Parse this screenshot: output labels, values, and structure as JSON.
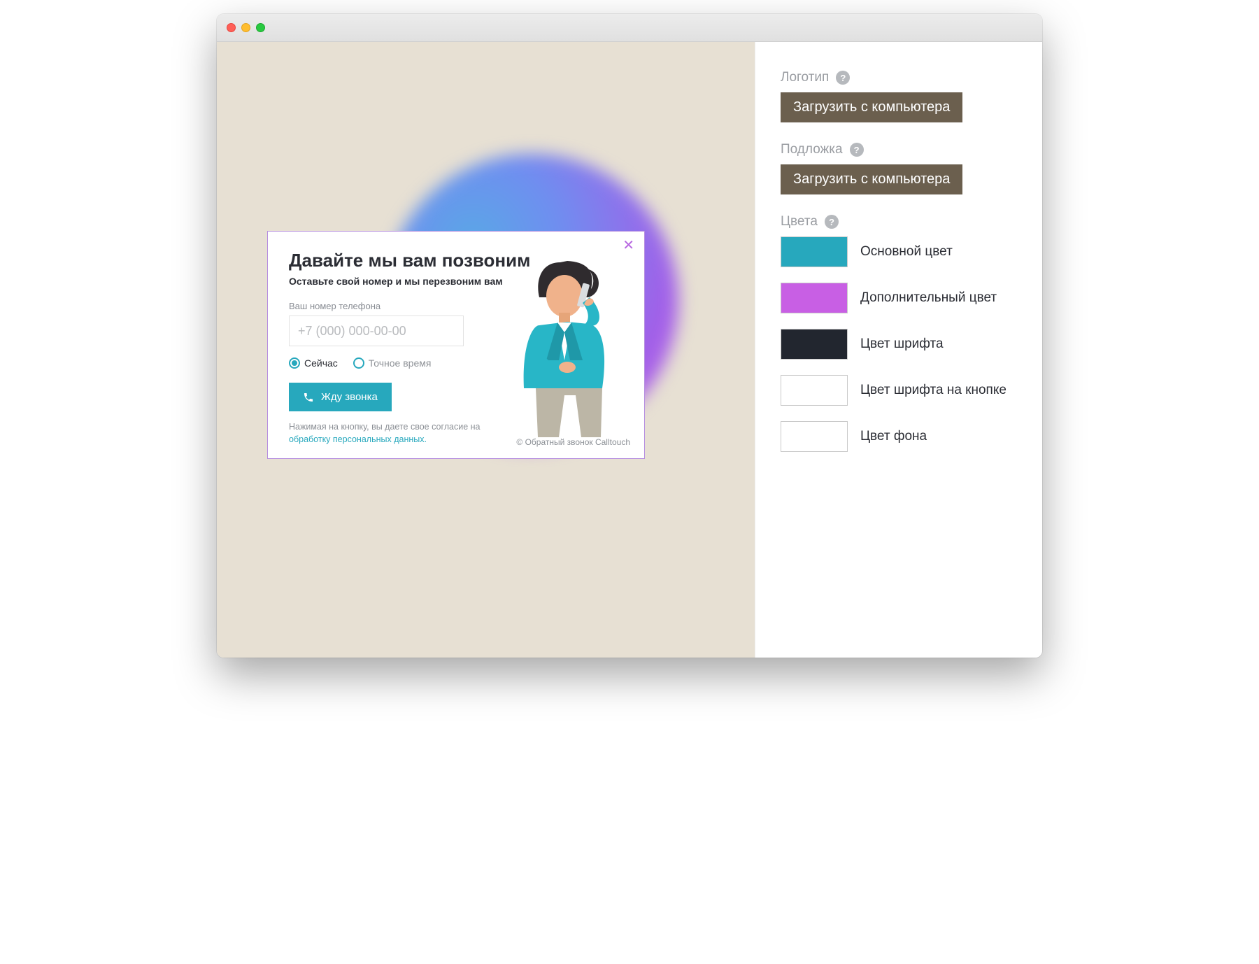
{
  "widget": {
    "title": "Давайте мы вам позвоним",
    "subtitle": "Оставьте свой номер и мы перезвоним вам",
    "phone_label": "Ваш номер телефона",
    "phone_placeholder": "+7 (000) 000-00-00",
    "radio_now": "Сейчас",
    "radio_exact": "Точное время",
    "button": "Жду звонка",
    "consent_prefix": "Нажимая на кнопку, вы даете свое согласие на ",
    "consent_link": "обработку персональных данных.",
    "copyright": "© Обратный звонок Calltouch"
  },
  "sidebar": {
    "logo_label": "Логотип",
    "bg_label": "Подложка",
    "upload": "Загрузить с компьютера",
    "colors_label": "Цвета",
    "help": "?",
    "colors": [
      {
        "label": "Основной цвет",
        "hex": "#27a8bd"
      },
      {
        "label": "Дополнительный цвет",
        "hex": "#c85fe4"
      },
      {
        "label": "Цвет шрифта",
        "hex": "#22262f"
      },
      {
        "label": "Цвет шрифта на кнопке",
        "hex": "#ffffff"
      },
      {
        "label": "Цвет фона",
        "hex": "#ffffff"
      }
    ]
  }
}
